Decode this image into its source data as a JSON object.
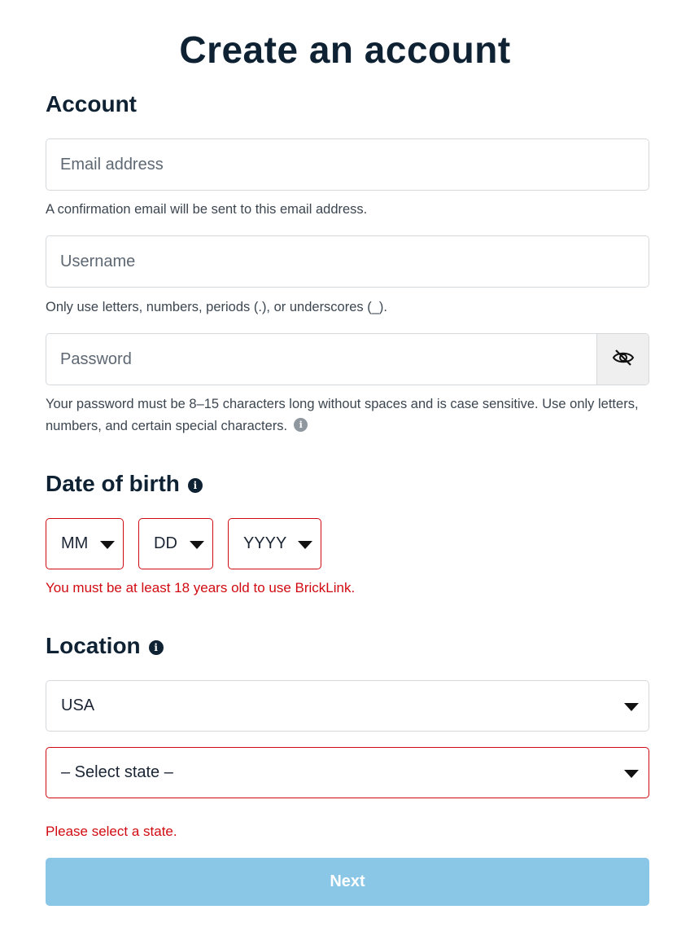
{
  "page": {
    "title": "Create an account"
  },
  "account": {
    "heading": "Account",
    "email": {
      "placeholder": "Email address",
      "hint": "A confirmation email will be sent to this email address."
    },
    "username": {
      "placeholder": "Username",
      "hint": "Only use letters, numbers, periods (.), or underscores (_)."
    },
    "password": {
      "placeholder": "Password",
      "hint": "Your password must be 8–15 characters long without spaces and is case sensitive. Use only letters, numbers, and certain special characters.",
      "toggle_icon": "eye-slash-icon"
    }
  },
  "dob": {
    "heading": "Date of birth",
    "month": "MM",
    "day": "DD",
    "year": "YYYY",
    "error": "You must be at least 18 years old to use BrickLink."
  },
  "location": {
    "heading": "Location",
    "country": "USA",
    "state": "– Select state –",
    "error": "Please select a state."
  },
  "actions": {
    "next_label": "Next"
  },
  "colors": {
    "error": "#d10a11",
    "primary_disabled": "#8ac6e6",
    "heading": "#0f2233"
  }
}
